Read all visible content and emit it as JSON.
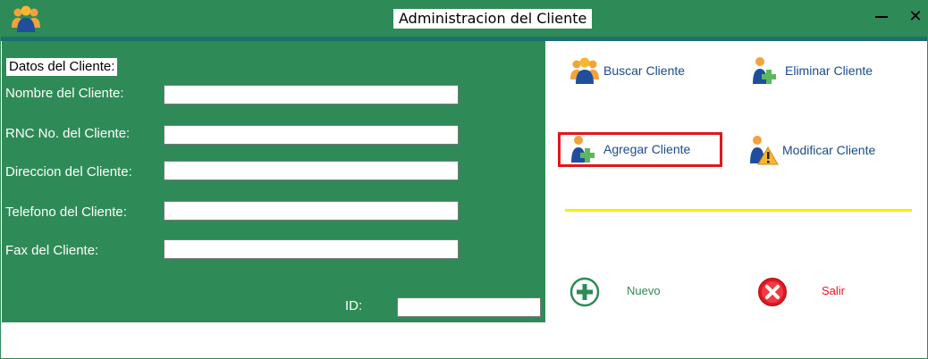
{
  "window": {
    "title": "Administracion del Cliente",
    "minimize_label": "—",
    "close_label": "✕"
  },
  "form": {
    "section_title": "Datos del Cliente:",
    "fields": [
      {
        "label": "Nombre del Cliente:",
        "value": ""
      },
      {
        "label": "RNC No. del Cliente:",
        "value": ""
      },
      {
        "label": "Direccion del Cliente:",
        "value": ""
      },
      {
        "label": "Telefono del Cliente:",
        "value": ""
      },
      {
        "label": "Fax del Cliente:",
        "value": ""
      }
    ],
    "id_label": "ID:",
    "id_value": ""
  },
  "actions": {
    "buscar": "Buscar Cliente",
    "eliminar": "Eliminar Cliente",
    "agregar": "Agregar Cliente",
    "modificar": "Modificar Cliente",
    "nuevo": "Nuevo",
    "salir": "Salir"
  },
  "colors": {
    "panel_green": "#2e8b57",
    "teal_strip": "#1e6e6e",
    "highlight_red": "#e0161e",
    "separator_yellow": "#f4f000",
    "action_text": "#1a4b8c",
    "nuevo_text": "#2e8b57",
    "salir_text": "#e0161e"
  },
  "icons": {
    "app": "users-group-icon",
    "buscar": "users-group-icon",
    "eliminar": "user-plus-icon",
    "agregar": "user-plus-icon",
    "modificar": "user-warning-icon",
    "nuevo": "plus-circle-icon",
    "salir": "x-circle-icon"
  }
}
